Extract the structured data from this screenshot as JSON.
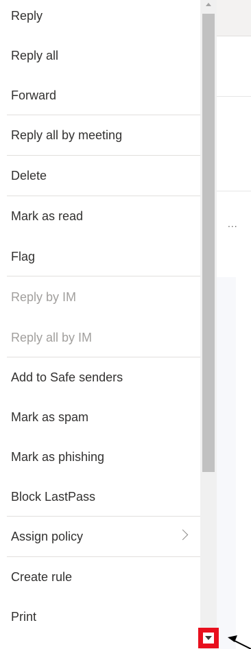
{
  "menu": {
    "items": [
      {
        "label": "Reply",
        "disabled": false
      },
      {
        "label": "Reply all",
        "disabled": false
      },
      {
        "label": "Forward",
        "disabled": false
      },
      {
        "label": "Reply all by meeting",
        "disabled": false
      },
      {
        "label": "Delete",
        "disabled": false
      },
      {
        "label": "Mark as read",
        "disabled": false
      },
      {
        "label": "Flag",
        "disabled": false
      },
      {
        "label": "Reply by IM",
        "disabled": true
      },
      {
        "label": "Reply all by IM",
        "disabled": true
      },
      {
        "label": "Add to Safe senders",
        "disabled": false
      },
      {
        "label": "Mark as spam",
        "disabled": false
      },
      {
        "label": "Mark as phishing",
        "disabled": false
      },
      {
        "label": "Block LastPass",
        "disabled": false
      },
      {
        "label": "Assign policy",
        "disabled": false,
        "submenu": true,
        "chevron_icon": "chevron-right-icon"
      },
      {
        "label": "Create rule",
        "disabled": false
      },
      {
        "label": "Print",
        "disabled": false
      }
    ]
  },
  "background": {
    "more_label": "..."
  },
  "scrollbar": {
    "up_icon": "scroll-up-arrow-icon",
    "down_icon": "scroll-down-arrow-icon",
    "highlight_color": "#e8101e"
  },
  "annotation": {
    "icon": "pointer-arrow-icon",
    "color": "#000000"
  },
  "colors": {
    "text": "#323130",
    "disabled_text": "#a19f9d",
    "separator": "#e1dfdd"
  }
}
